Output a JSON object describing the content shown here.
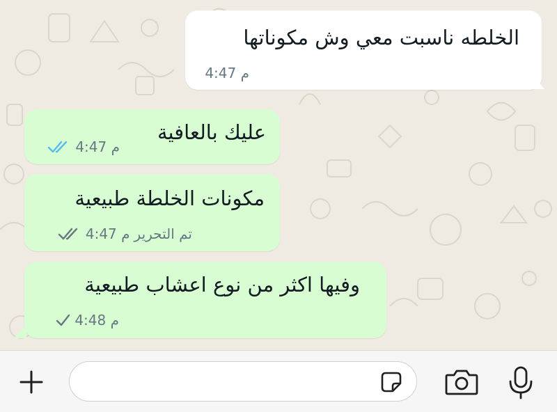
{
  "messages": [
    {
      "direction": "incoming",
      "text": "الخلطه ناسبت معي وش مكوناتها",
      "time": "4:47 م"
    },
    {
      "direction": "outgoing",
      "text": "عليك بالعافية",
      "time": "4:47 م",
      "status": "read"
    },
    {
      "direction": "outgoing",
      "text": "مكونات الخلطة طبيعية",
      "edited_label": "تم التحرير",
      "time": "4:47 م",
      "status": "delivered"
    },
    {
      "direction": "outgoing",
      "text": "وفيها اكثر من نوع اعشاب طبيعية",
      "time": "4:48 م",
      "status": "sent"
    }
  ],
  "input_bar": {
    "attach_icon": "plus-icon",
    "sticker_icon": "sticker-icon",
    "camera_icon": "camera-icon",
    "mic_icon": "microphone-icon",
    "message_value": ""
  },
  "colors": {
    "chat_background": "#efeae2",
    "incoming_bubble": "#ffffff",
    "outgoing_bubble": "#d9fdd3",
    "read_tick": "#53bdeb",
    "unread_tick": "#667781"
  }
}
